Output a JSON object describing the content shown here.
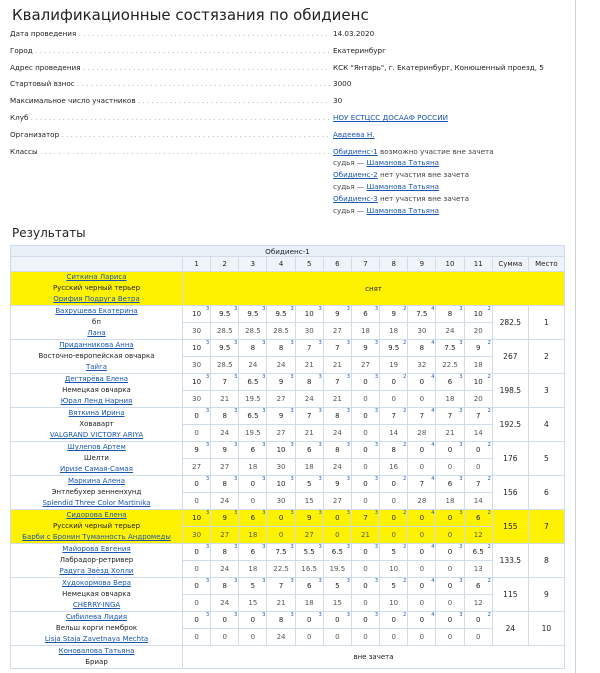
{
  "title": "Квалификационные состязания по обидиенс",
  "info": [
    {
      "label": "Дата проведения",
      "value": "14.03.2020"
    },
    {
      "label": "Город",
      "value": "Екатеринбург"
    },
    {
      "label": "Адрес проведения",
      "value": "КСК \"Янтарь\", г. Екатеринбург, Конюшенный проезд, 5"
    },
    {
      "label": "Стартовый взнос",
      "value": "3000"
    },
    {
      "label": "Максимальное число участников",
      "value": "30"
    },
    {
      "label": "Клуб",
      "value": "НОУ ЕСТЦСС ДОСААФ РОССИИ"
    },
    {
      "label": "Организатор",
      "value": "Авдеева Н."
    },
    {
      "label": "Классы",
      "value": ""
    }
  ],
  "classes": [
    {
      "name": "Обидиенс-1",
      "note": "возможно участие вне зачета",
      "judge_prefix": "судья — ",
      "judge": "Шаманова Татьяна"
    },
    {
      "name": "Обидиенс-2",
      "note": "нет участия вне зачета",
      "judge_prefix": "судья — ",
      "judge": "Шаманова Татьяна"
    },
    {
      "name": "Обидиенс-3",
      "note": "нет участия вне зачета",
      "judge_prefix": "судья — ",
      "judge": "Шаманова Татьяна"
    }
  ],
  "results_title": "Результаты",
  "table": {
    "caption": "Обидиенс-1",
    "columns": [
      "1",
      "2",
      "3",
      "4",
      "5",
      "6",
      "7",
      "8",
      "9",
      "10",
      "11",
      "Сумма",
      "Место"
    ],
    "rows": [
      {
        "handler": "Ситкина Лариса",
        "breed": "Русский черный терьер",
        "dog": "Орифия Подруга Ветра",
        "highlight": true,
        "note": "снят"
      },
      {
        "handler": "Вахрушева Екатерина",
        "breed": "бп",
        "dog": "Лана",
        "highlight": false,
        "scores": [
          "10",
          "9.5",
          "9.5",
          "9.5",
          "10",
          "9",
          "6",
          "9",
          "7.5",
          "8",
          "10"
        ],
        "coef": [
          "3",
          "3",
          "3",
          "3",
          "3",
          "3",
          "3",
          "2",
          "4",
          "3",
          "2"
        ],
        "points": [
          "30",
          "28.5",
          "28.5",
          "28.5",
          "30",
          "27",
          "18",
          "18",
          "30",
          "24",
          "20"
        ],
        "sum": "282.5",
        "place": "1"
      },
      {
        "handler": "Приданникова Анна",
        "breed": "Восточно-европейская овчарка",
        "dog": "Тайга",
        "highlight": false,
        "scores": [
          "10",
          "9.5",
          "8",
          "8",
          "7",
          "7",
          "9",
          "9.5",
          "8",
          "7.5",
          "9"
        ],
        "coef": [
          "3",
          "3",
          "3",
          "3",
          "3",
          "3",
          "3",
          "2",
          "4",
          "3",
          "2"
        ],
        "points": [
          "30",
          "28.5",
          "24",
          "24",
          "21",
          "21",
          "27",
          "19",
          "32",
          "22.5",
          "18"
        ],
        "sum": "267",
        "place": "2"
      },
      {
        "handler": "Дегтярёва Елена",
        "breed": "Немецкая овчарка",
        "dog": "Юрал Ленд Нарния",
        "highlight": false,
        "scores": [
          "10",
          "7",
          "6.5",
          "9",
          "8",
          "7",
          "0",
          "0",
          "0",
          "6",
          "10"
        ],
        "coef": [
          "3",
          "3",
          "3",
          "3",
          "3",
          "3",
          "3",
          "2",
          "4",
          "3",
          "2"
        ],
        "points": [
          "30",
          "21",
          "19.5",
          "27",
          "24",
          "21",
          "0",
          "0",
          "0",
          "18",
          "20"
        ],
        "sum": "198.5",
        "place": "3"
      },
      {
        "handler": "Вяткина Ирина",
        "breed": "Ховаварт",
        "dog": "VALGRAND VICTORY ARIYA",
        "highlight": false,
        "scores": [
          "0",
          "8",
          "6.5",
          "9",
          "7",
          "8",
          "0",
          "7",
          "7",
          "7",
          "7"
        ],
        "coef": [
          "3",
          "3",
          "3",
          "3",
          "3",
          "3",
          "3",
          "2",
          "4",
          "3",
          "2"
        ],
        "points": [
          "0",
          "24",
          "19.5",
          "27",
          "21",
          "24",
          "0",
          "14",
          "28",
          "21",
          "14"
        ],
        "sum": "192.5",
        "place": "4"
      },
      {
        "handler": "Шулепов Артем",
        "breed": "Шелти",
        "dog": "Иризе Самая-Самая",
        "highlight": false,
        "scores": [
          "9",
          "9",
          "6",
          "10",
          "6",
          "8",
          "0",
          "8",
          "0",
          "0",
          "0"
        ],
        "coef": [
          "3",
          "3",
          "3",
          "3",
          "3",
          "3",
          "3",
          "2",
          "4",
          "3",
          "2"
        ],
        "points": [
          "27",
          "27",
          "18",
          "30",
          "18",
          "24",
          "0",
          "16",
          "0",
          "0",
          "0"
        ],
        "sum": "176",
        "place": "5"
      },
      {
        "handler": "Маркина Алена",
        "breed": "Энтлебухер зенненхунд",
        "dog": "Splendid Three Color Martinika",
        "highlight": false,
        "scores": [
          "0",
          "8",
          "0",
          "10",
          "5",
          "9",
          "0",
          "0",
          "7",
          "6",
          "7"
        ],
        "coef": [
          "3",
          "3",
          "3",
          "3",
          "3",
          "3",
          "3",
          "2",
          "4",
          "3",
          "2"
        ],
        "points": [
          "0",
          "24",
          "0",
          "30",
          "15",
          "27",
          "0",
          "0",
          "28",
          "18",
          "14"
        ],
        "sum": "156",
        "place": "6"
      },
      {
        "handler": "Сидорова Елена",
        "breed": "Русский черный терьер",
        "dog": "Барби с Бронин Туманность Андромеды",
        "highlight": true,
        "scores": [
          "10",
          "9",
          "6",
          "0",
          "9",
          "0",
          "7",
          "0",
          "0",
          "0",
          "6"
        ],
        "coef": [
          "3",
          "3",
          "3",
          "3",
          "3",
          "3",
          "3",
          "2",
          "4",
          "3",
          "2"
        ],
        "points": [
          "30",
          "27",
          "18",
          "0",
          "27",
          "0",
          "21",
          "0",
          "0",
          "0",
          "12"
        ],
        "sum": "155",
        "place": "7"
      },
      {
        "handler": "Майорова Евгения",
        "breed": "Лабрадор-ретривер",
        "dog": "Радуга Звёзд Холли",
        "highlight": false,
        "scores": [
          "0",
          "8",
          "6",
          "7.5",
          "5.5",
          "6.5",
          "0",
          "5",
          "0",
          "0",
          "6.5"
        ],
        "coef": [
          "3",
          "3",
          "3",
          "3",
          "3",
          "3",
          "3",
          "2",
          "4",
          "3",
          "2"
        ],
        "points": [
          "0",
          "24",
          "18",
          "22.5",
          "16.5",
          "19.5",
          "0",
          "10",
          "0",
          "0",
          "13"
        ],
        "sum": "133.5",
        "place": "8"
      },
      {
        "handler": "Худокормова Вера",
        "breed": "Немецкая овчарка",
        "dog": "CHERRY-INGA",
        "highlight": false,
        "scores": [
          "0",
          "8",
          "5",
          "7",
          "6",
          "5",
          "0",
          "5",
          "0",
          "0",
          "6"
        ],
        "coef": [
          "3",
          "3",
          "3",
          "3",
          "3",
          "3",
          "3",
          "2",
          "4",
          "3",
          "2"
        ],
        "points": [
          "0",
          "24",
          "15",
          "21",
          "18",
          "15",
          "0",
          "10",
          "0",
          "0",
          "12"
        ],
        "sum": "115",
        "place": "9"
      },
      {
        "handler": "Сибилева Лидия",
        "breed": "Вельш корги пемброк",
        "dog": "Lisja Staja Zavetnaya Mechta",
        "highlight": false,
        "scores": [
          "0",
          "0",
          "0",
          "8",
          "0",
          "0",
          "0",
          "0",
          "0",
          "0",
          "0"
        ],
        "coef": [
          "3",
          "3",
          "3",
          "3",
          "3",
          "3",
          "3",
          "2",
          "4",
          "3",
          "2"
        ],
        "points": [
          "0",
          "0",
          "0",
          "24",
          "0",
          "0",
          "0",
          "0",
          "0",
          "0",
          "0"
        ],
        "sum": "24",
        "place": "10"
      },
      {
        "handler": "Коновалова Татьяна",
        "breed": "Бриар",
        "dog": "",
        "highlight": false,
        "note": "вне зачета"
      }
    ]
  }
}
